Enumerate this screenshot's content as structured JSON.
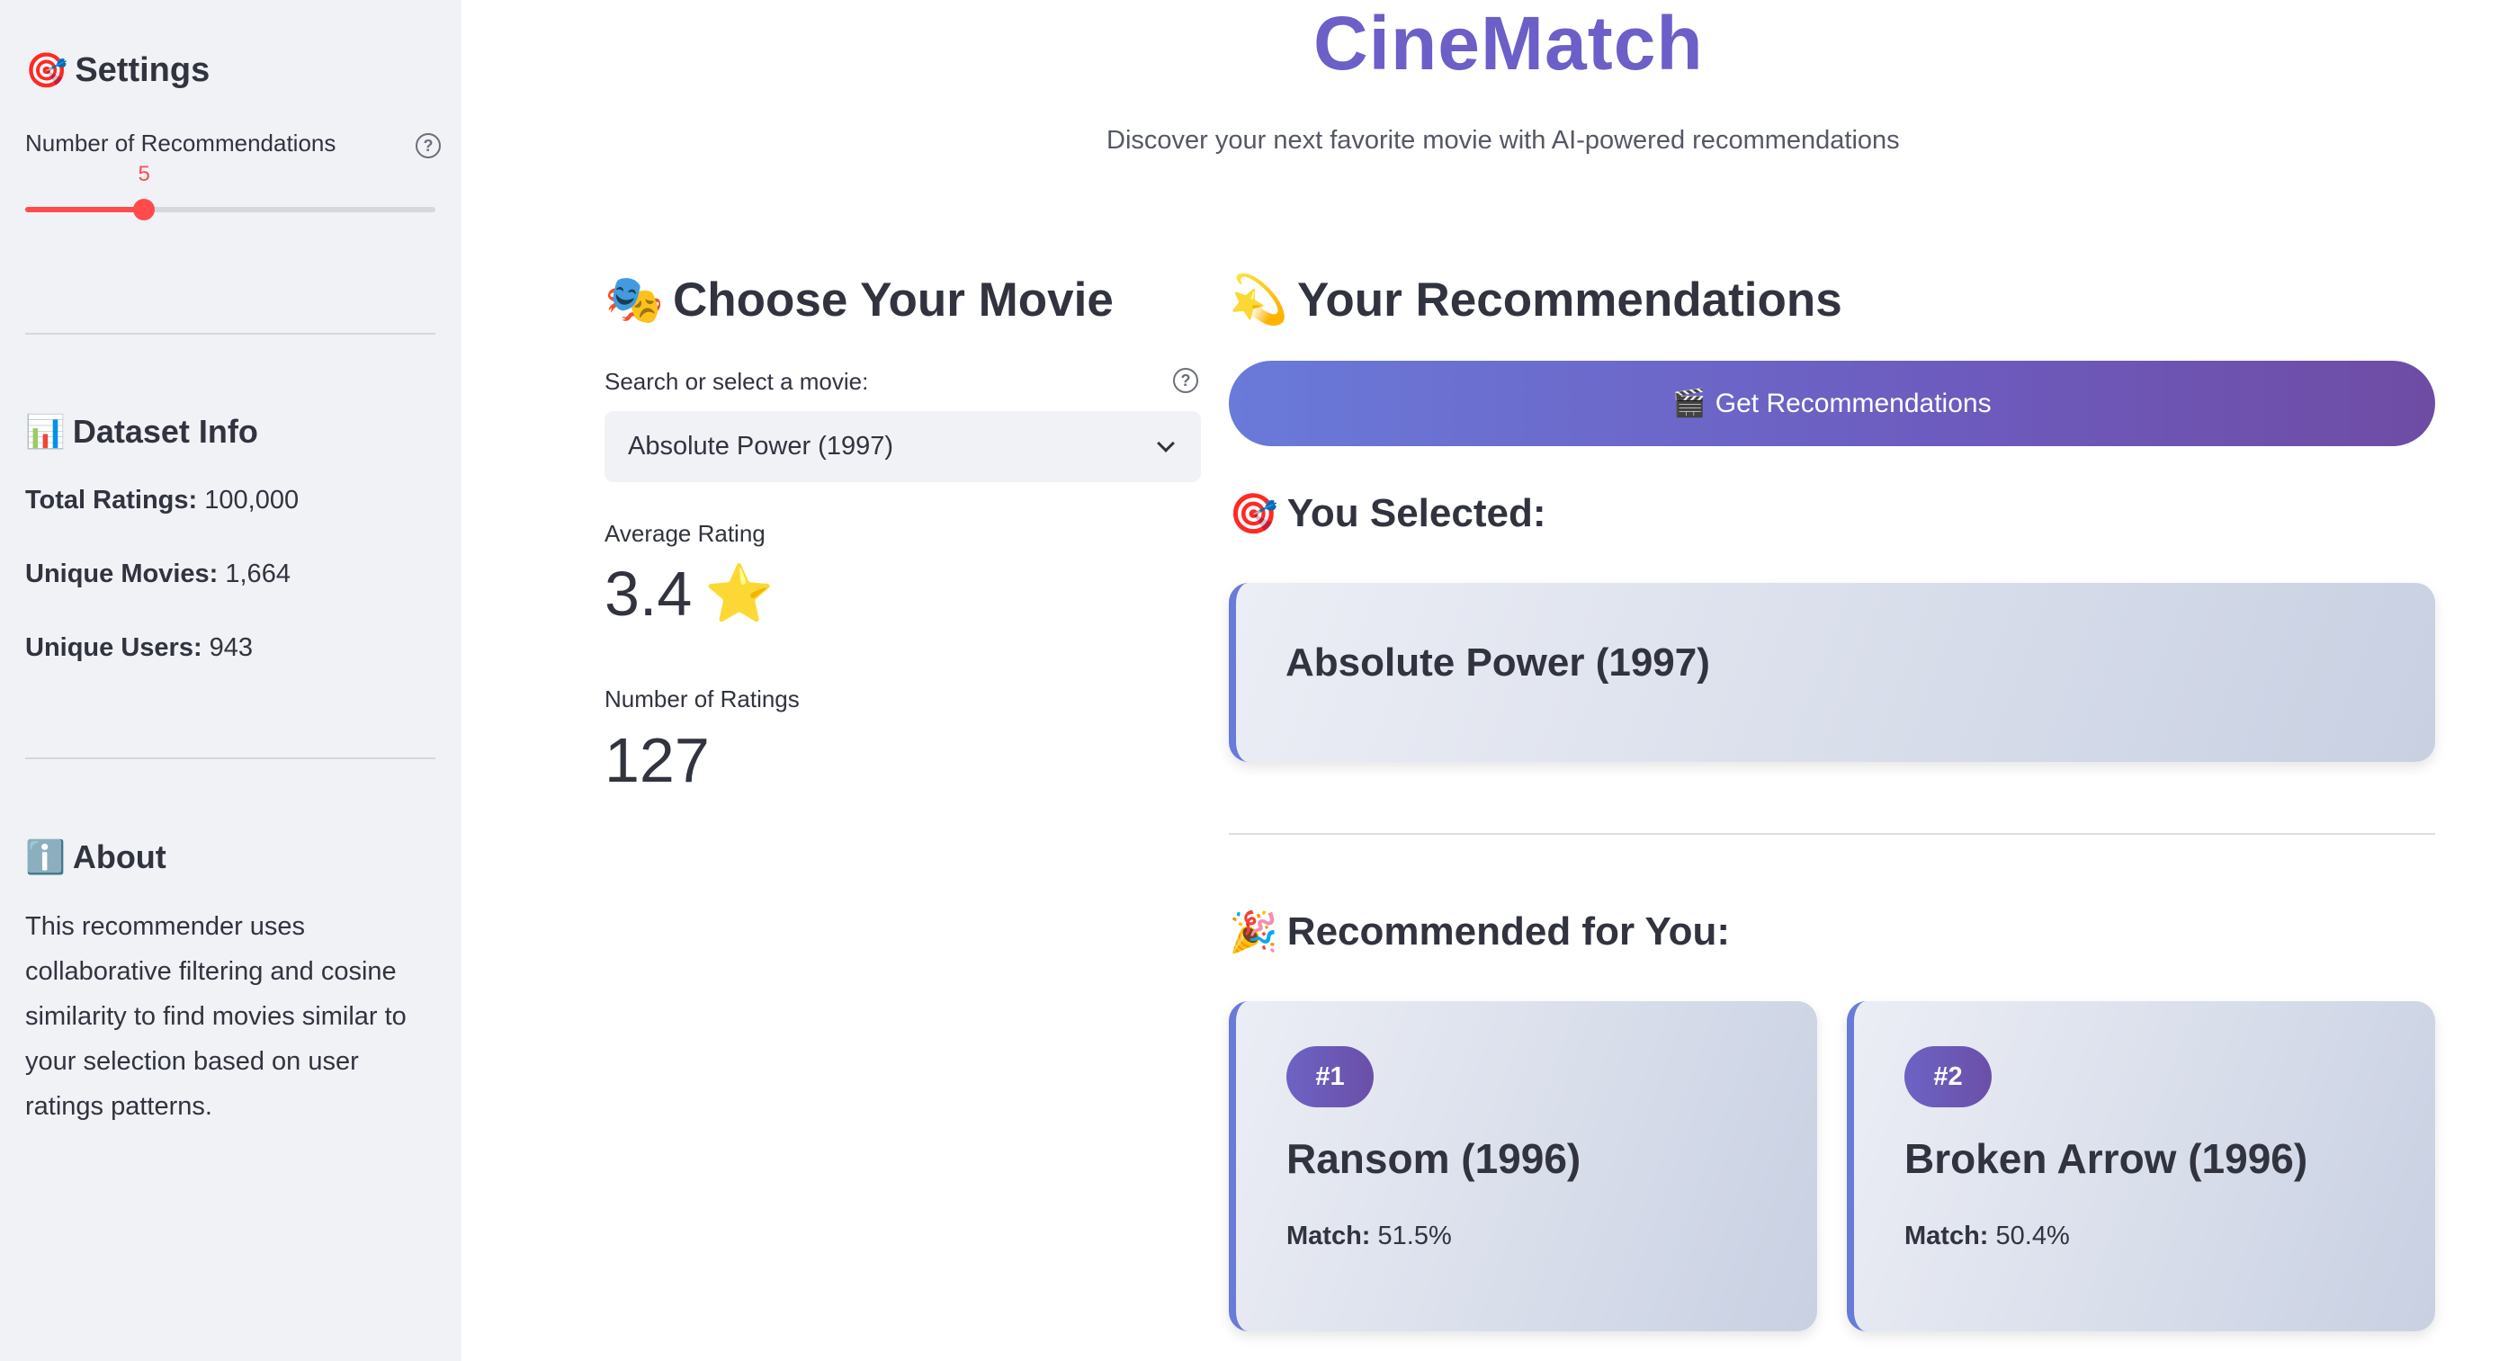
{
  "app": {
    "title": "CineMatch",
    "subtitle": "Discover your next favorite movie with AI-powered recommendations"
  },
  "sidebar": {
    "settings_heading": "Settings",
    "settings_icon": "🎯",
    "slider": {
      "label": "Number of Recommendations",
      "value": "5",
      "min": 1,
      "max": 15,
      "fraction": 0.29
    },
    "dataset_heading": "Dataset Info",
    "dataset_icon": "📊",
    "dataset": {
      "total_ratings_label": "Total Ratings:",
      "total_ratings_value": "100,000",
      "unique_movies_label": "Unique Movies:",
      "unique_movies_value": "1,664",
      "unique_users_label": "Unique Users:",
      "unique_users_value": "943"
    },
    "about_heading": "About",
    "about_icon": "ℹ️",
    "about_text": "This recommender uses collaborative filtering and cosine similarity to find movies similar to your selection based on user ratings patterns."
  },
  "choose": {
    "heading": "Choose Your Movie",
    "heading_icon": "🎭",
    "select_label": "Search or select a movie:",
    "select_value": "Absolute Power (1997)",
    "avg_rating_label": "Average Rating",
    "avg_rating_value": "3.4",
    "avg_rating_icon": "⭐",
    "num_ratings_label": "Number of Ratings",
    "num_ratings_value": "127"
  },
  "recommendations": {
    "heading": "Your Recommendations",
    "heading_icon": "💫",
    "button_label": "Get Recommendations",
    "button_icon": "🎬",
    "selected_heading": "You Selected:",
    "selected_icon": "🎯",
    "selected_movie": "Absolute Power (1997)",
    "recommended_heading": "Recommended for You:",
    "recommended_icon": "🎉",
    "match_label": "Match:",
    "items": [
      {
        "rank": "#1",
        "title": "Ransom (1996)",
        "match": "51.5%"
      },
      {
        "rank": "#2",
        "title": "Broken Arrow (1996)",
        "match": "50.4%"
      }
    ]
  },
  "colors": {
    "accent": "#6c5fc7",
    "slider": "#ff4b4b",
    "sidebar_bg": "#f0f2f6"
  }
}
